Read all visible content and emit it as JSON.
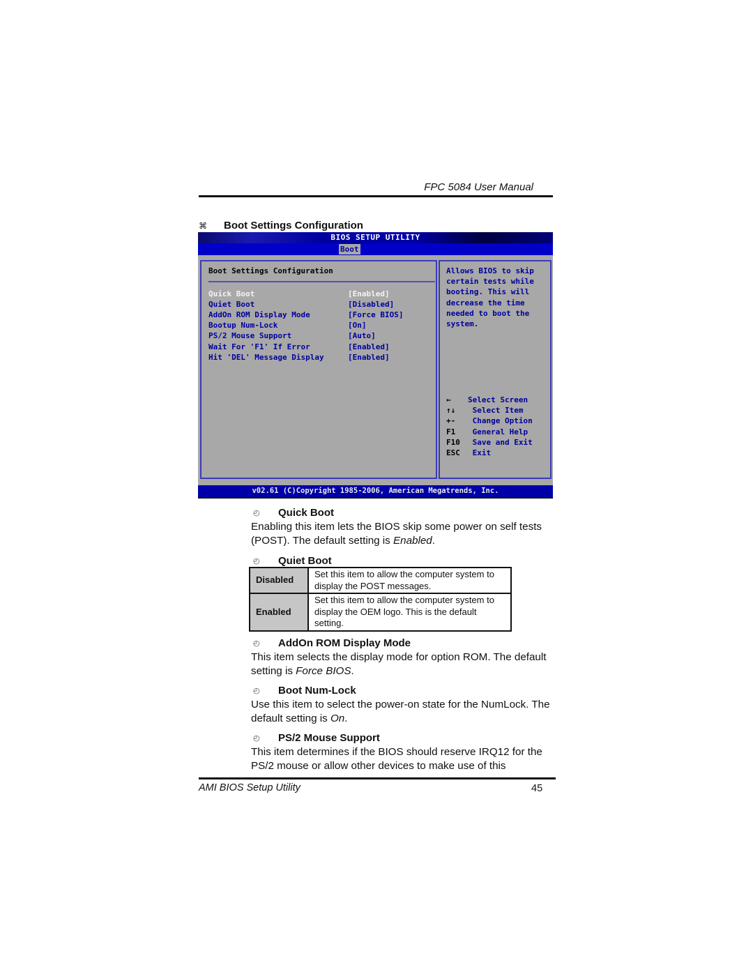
{
  "page": {
    "running_header": "FPC 5084 User Manual",
    "section_glyph": "⌘",
    "section_title": "Boot Settings Configuration",
    "footer_left": "AMI BIOS Setup Utility",
    "page_number": "45"
  },
  "bios": {
    "title": "BIOS SETUP UTILITY",
    "active_tab": "Boot",
    "panel_title": "Boot Settings Configuration",
    "items": [
      {
        "label": "Quick Boot",
        "value": "[Enabled]",
        "selected": true
      },
      {
        "label": "Quiet Boot",
        "value": "[Disabled]",
        "selected": false
      },
      {
        "label": "AddOn ROM Display Mode",
        "value": "[Force BIOS]",
        "selected": false
      },
      {
        "label": "Bootup Num-Lock",
        "value": "[On]",
        "selected": false
      },
      {
        "label": "PS/2 Mouse Support",
        "value": "[Auto]",
        "selected": false
      },
      {
        "label": "Wait For 'F1' If Error",
        "value": "[Enabled]",
        "selected": false
      },
      {
        "label": "Hit 'DEL' Message Display",
        "value": "[Enabled]",
        "selected": false
      }
    ],
    "help_text": "Allows BIOS to skip\ncertain tests while\nbooting. This will\ndecrease the time\nneeded to boot the\nsystem.",
    "keys": [
      {
        "key": "←",
        "desc": "Select Screen"
      },
      {
        "key": "↑↓",
        "desc": " Select Item"
      },
      {
        "key": "+-",
        "desc": " Change Option"
      },
      {
        "key": "F1",
        "desc": " General Help"
      },
      {
        "key": "F10",
        "desc": " Save and Exit"
      },
      {
        "key": "ESC",
        "desc": " Exit"
      }
    ],
    "footer": "v02.61 (C)Copyright 1985-2006, American Megatrends, Inc.",
    "colors": {
      "title_bar": "#0000a0",
      "tab_bar": "#0000c8",
      "panel_bg": "#a8a8a8",
      "item_text": "#00009c",
      "border": "#3a3ab8"
    }
  },
  "content": {
    "bullet_icon": "◴",
    "quick_boot": {
      "heading": "Quick Boot",
      "text_before": "Enabling this item lets the BIOS skip some power on self tests (POST). The default setting is ",
      "default": "Enabled",
      "text_after": "."
    },
    "quiet_boot": {
      "heading": "Quiet Boot",
      "options": [
        {
          "option": "Disabled",
          "description": "Set this item to allow the computer system to display the POST messages."
        },
        {
          "option": "Enabled",
          "description": "Set this item to allow the computer system to display the OEM logo. This is the default setting."
        }
      ]
    },
    "addon_rom": {
      "heading": "AddOn ROM Display Mode",
      "text_before": "This item selects the display mode for option ROM. The default setting is ",
      "default": "Force BIOS",
      "text_after": "."
    },
    "boot_numlock": {
      "heading": "Boot Num-Lock",
      "text_before": "Use this item to select the power-on state for the NumLock. The default setting is ",
      "default": "On",
      "text_after": "."
    },
    "ps2_mouse": {
      "heading": "PS/2 Mouse Support",
      "text": "This item determines if the BIOS should reserve IRQ12 for the PS/2 mouse or allow other devices to make use of this"
    }
  }
}
